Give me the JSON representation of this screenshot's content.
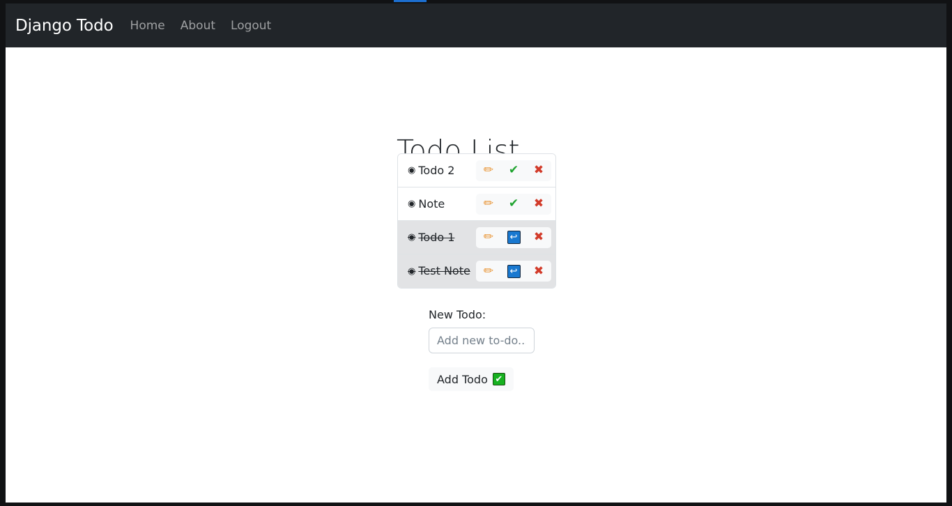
{
  "navbar": {
    "brand": "Django Todo",
    "links": [
      {
        "label": "Home",
        "name": "nav-link-home"
      },
      {
        "label": "About",
        "name": "nav-link-about"
      },
      {
        "label": "Logout",
        "name": "nav-link-logout"
      }
    ]
  },
  "main": {
    "title": "Todo List",
    "bullet": "◉"
  },
  "todos": [
    {
      "text": "Todo 2",
      "completed": false,
      "actions": [
        {
          "name": "edit-icon",
          "glyph": "✏",
          "kind": "edit"
        },
        {
          "name": "complete-check-icon",
          "glyph": "✔",
          "kind": "check"
        },
        {
          "name": "delete-cross-icon",
          "glyph": "✖",
          "kind": "cross"
        }
      ]
    },
    {
      "text": "Note",
      "completed": false,
      "actions": [
        {
          "name": "edit-icon",
          "glyph": "✏",
          "kind": "edit"
        },
        {
          "name": "complete-check-icon",
          "glyph": "✔",
          "kind": "check"
        },
        {
          "name": "delete-cross-icon",
          "glyph": "✖",
          "kind": "cross"
        }
      ]
    },
    {
      "text": "Todo 1",
      "completed": true,
      "actions": [
        {
          "name": "edit-icon",
          "glyph": "✏",
          "kind": "edit"
        },
        {
          "name": "undo-arrow-icon",
          "glyph": "↩",
          "kind": "undo"
        },
        {
          "name": "delete-cross-icon",
          "glyph": "✖",
          "kind": "cross"
        }
      ]
    },
    {
      "text": "Test Note",
      "completed": true,
      "actions": [
        {
          "name": "edit-icon",
          "glyph": "✏",
          "kind": "edit"
        },
        {
          "name": "undo-arrow-icon",
          "glyph": "↩",
          "kind": "undo"
        },
        {
          "name": "delete-cross-icon",
          "glyph": "✖",
          "kind": "cross"
        }
      ]
    }
  ],
  "form": {
    "label": "New Todo:",
    "input_value": "",
    "input_placeholder": "Add new to-do...",
    "submit_label": "Add Todo",
    "submit_glyph": "✔"
  },
  "colors": {
    "navbar_bg": "#212529",
    "page_bg": "#ffffff",
    "border": "#dee2e6",
    "done_row_bg": "#e2e3e5",
    "btn_group_bg": "#f8f9fa",
    "edit_icon": "#e8912d",
    "check_icon": "#1fa32f",
    "cross_icon": "#d23b2a",
    "undo_icon_bg": "#1878d0",
    "accent_progress": "#1d6fd0"
  }
}
